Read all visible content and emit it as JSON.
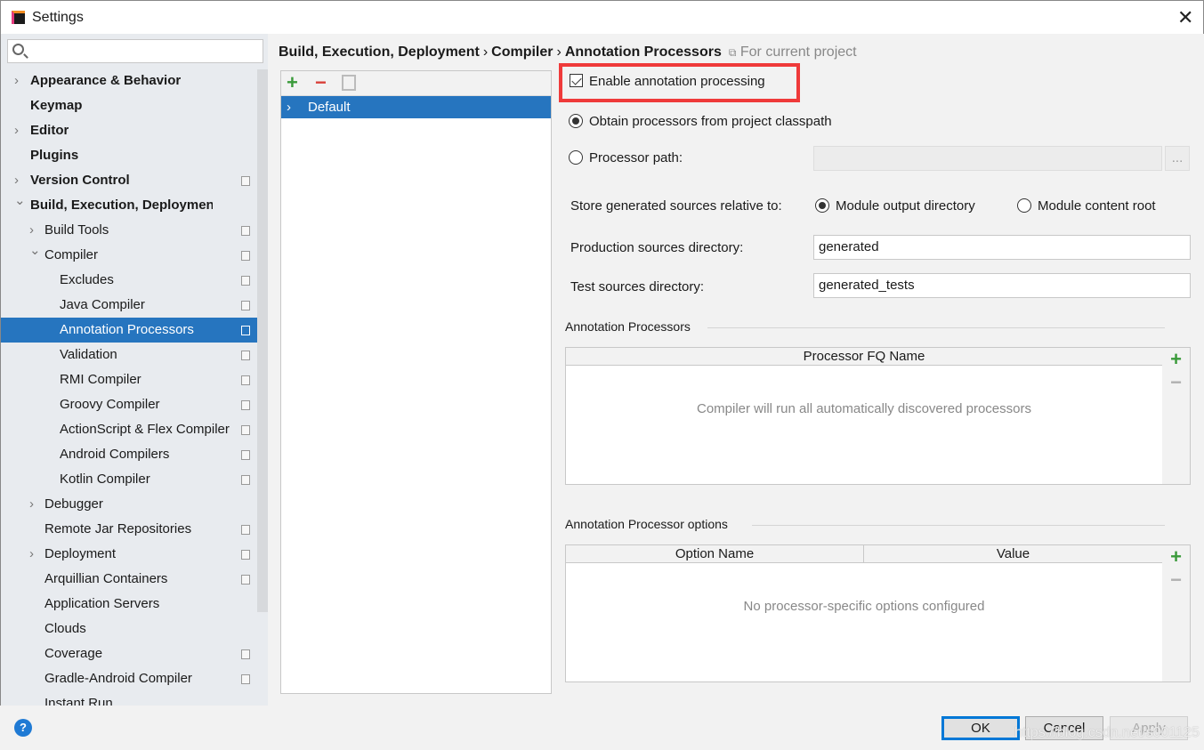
{
  "window": {
    "title": "Settings"
  },
  "search": {
    "placeholder": ""
  },
  "sidebar": {
    "items": [
      {
        "label": "Appearance & Behavior",
        "level": 0,
        "bold": true,
        "chevron": "right",
        "project": false
      },
      {
        "label": "Keymap",
        "level": 0,
        "bold": true,
        "chevron": "",
        "project": false
      },
      {
        "label": "Editor",
        "level": 0,
        "bold": true,
        "chevron": "right",
        "project": false
      },
      {
        "label": "Plugins",
        "level": 0,
        "bold": true,
        "chevron": "",
        "project": false
      },
      {
        "label": "Version Control",
        "level": 0,
        "bold": true,
        "chevron": "right",
        "project": true
      },
      {
        "label": "Build, Execution, Deployment",
        "level": 0,
        "bold": true,
        "chevron": "down",
        "project": false
      },
      {
        "label": "Build Tools",
        "level": 1,
        "chevron": "right",
        "project": true
      },
      {
        "label": "Compiler",
        "level": 1,
        "chevron": "down",
        "project": true
      },
      {
        "label": "Excludes",
        "level": 2,
        "project": true
      },
      {
        "label": "Java Compiler",
        "level": 2,
        "project": true
      },
      {
        "label": "Annotation Processors",
        "level": 2,
        "project": true,
        "selected": true
      },
      {
        "label": "Validation",
        "level": 2,
        "project": true
      },
      {
        "label": "RMI Compiler",
        "level": 2,
        "project": true
      },
      {
        "label": "Groovy Compiler",
        "level": 2,
        "project": true
      },
      {
        "label": "ActionScript & Flex Compiler",
        "level": 2,
        "project": true
      },
      {
        "label": "Android Compilers",
        "level": 2,
        "project": true
      },
      {
        "label": "Kotlin Compiler",
        "level": 2,
        "project": true
      },
      {
        "label": "Debugger",
        "level": 1,
        "chevron": "right",
        "project": false
      },
      {
        "label": "Remote Jar Repositories",
        "level": 1,
        "project": true
      },
      {
        "label": "Deployment",
        "level": 1,
        "chevron": "right",
        "project": true
      },
      {
        "label": "Arquillian Containers",
        "level": 1,
        "project": true
      },
      {
        "label": "Application Servers",
        "level": 1,
        "project": false
      },
      {
        "label": "Clouds",
        "level": 1,
        "project": false
      },
      {
        "label": "Coverage",
        "level": 1,
        "project": true
      },
      {
        "label": "Gradle-Android Compiler",
        "level": 1,
        "project": true
      },
      {
        "label": "Instant Run",
        "level": 1,
        "project": false
      }
    ]
  },
  "breadcrumb": {
    "items": [
      "Build, Execution, Deployment",
      "Compiler",
      "Annotation Processors"
    ],
    "separator": "›",
    "hint": "For current project"
  },
  "profiles": {
    "add": "+",
    "remove": "−",
    "items": [
      "Default"
    ]
  },
  "settings": {
    "enable_label": "Enable annotation processing",
    "enable_checked": true,
    "obtain_label": "Obtain processors from project classpath",
    "path_label": "Processor path:",
    "path_value": "",
    "browse": "...",
    "store_label": "Store generated sources relative to:",
    "module_output": "Module output directory",
    "module_content": "Module content root",
    "prod_label": "Production sources directory:",
    "prod_value": "generated",
    "test_label": "Test sources directory:",
    "test_value": "generated_tests"
  },
  "processors": {
    "section": "Annotation Processors",
    "column": "Processor FQ Name",
    "empty": "Compiler will run all automatically discovered processors"
  },
  "options": {
    "section": "Annotation Processor options",
    "columns": [
      "Option Name",
      "Value"
    ],
    "empty": "No processor-specific options configured"
  },
  "footer": {
    "help": "?",
    "ok": "OK",
    "cancel": "Cancel",
    "apply": "Apply"
  },
  "watermark": "https://blog.csdn.net/s001125",
  "colors": {
    "selection": "#2675bf",
    "highlight_box": "#ef3a3a",
    "add": "#3a9a3a",
    "remove": "#d9413a"
  }
}
